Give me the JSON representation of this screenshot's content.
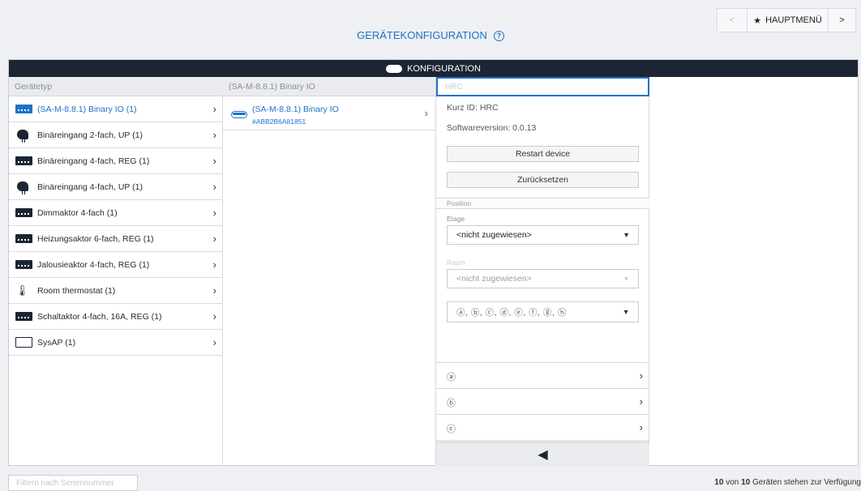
{
  "header": {
    "title": "GERÄTEKONFIGURATION",
    "nav": {
      "back": "<",
      "main_label": "HAUPTMENÜ",
      "forward": ">"
    }
  },
  "window": {
    "title": "KONFIGURATION"
  },
  "columns": {
    "device_type_header": "Gerätetyp",
    "sub_header": "(SA-M-8.8.1) Binary IO"
  },
  "device_types": [
    {
      "label": "(SA-M-8.8.1) Binary IO (1)",
      "icon": "module-icon",
      "selected": true
    },
    {
      "label": "Binäreingang 2-fach, UP (1)",
      "icon": "sensor-icon"
    },
    {
      "label": "Binäreingang 4-fach, REG (1)",
      "icon": "module-icon"
    },
    {
      "label": "Binäreingang 4-fach, UP (1)",
      "icon": "sensor-icon"
    },
    {
      "label": "Dimmaktor 4-fach (1)",
      "icon": "module-icon"
    },
    {
      "label": "Heizungsaktor 6-fach, REG (1)",
      "icon": "module-icon"
    },
    {
      "label": "Jalousieaktor 4-fach, REG (1)",
      "icon": "module-icon"
    },
    {
      "label": "Room thermostat (1)",
      "icon": "thermometer-icon"
    },
    {
      "label": "Schaltaktor 4-fach, 16A, REG (1)",
      "icon": "module-icon"
    },
    {
      "label": "SysAP (1)",
      "icon": "screen-icon"
    }
  ],
  "device": {
    "name": "(SA-M-8.8.1) Binary IO",
    "serial": "#ABB2B6A81851"
  },
  "detail": {
    "name_placeholder": "HRC",
    "short_id": "Kurz ID: HRC",
    "software_version": "Softwareversion: 0.0.13",
    "restart_button": "Restart device",
    "reset_button": "Zurücksetzen",
    "position_section": "Position",
    "floor_label": "Etage",
    "floor_value": "<nicht zugewiesen>",
    "room_label": "Raum",
    "room_value": "<nicht zugewiesen>",
    "channel_select": "ⓐ, ⓑ, ⓒ, ⓓ, ⓔ, ⓕ, ⓖ, ⓗ",
    "channels": [
      "ⓐ",
      "ⓑ",
      "ⓒ",
      "ⓓ",
      "ⓔ"
    ]
  },
  "footer": {
    "filter_placeholder": "Filtern nach Seriennummer",
    "status_count": "10",
    "status_mid": " von ",
    "status_total": "10",
    "status_suffix": " Geräten stehen zur Verfügung"
  },
  "colors": {
    "accent": "#1f72c8",
    "header_dark": "#1c2533"
  }
}
